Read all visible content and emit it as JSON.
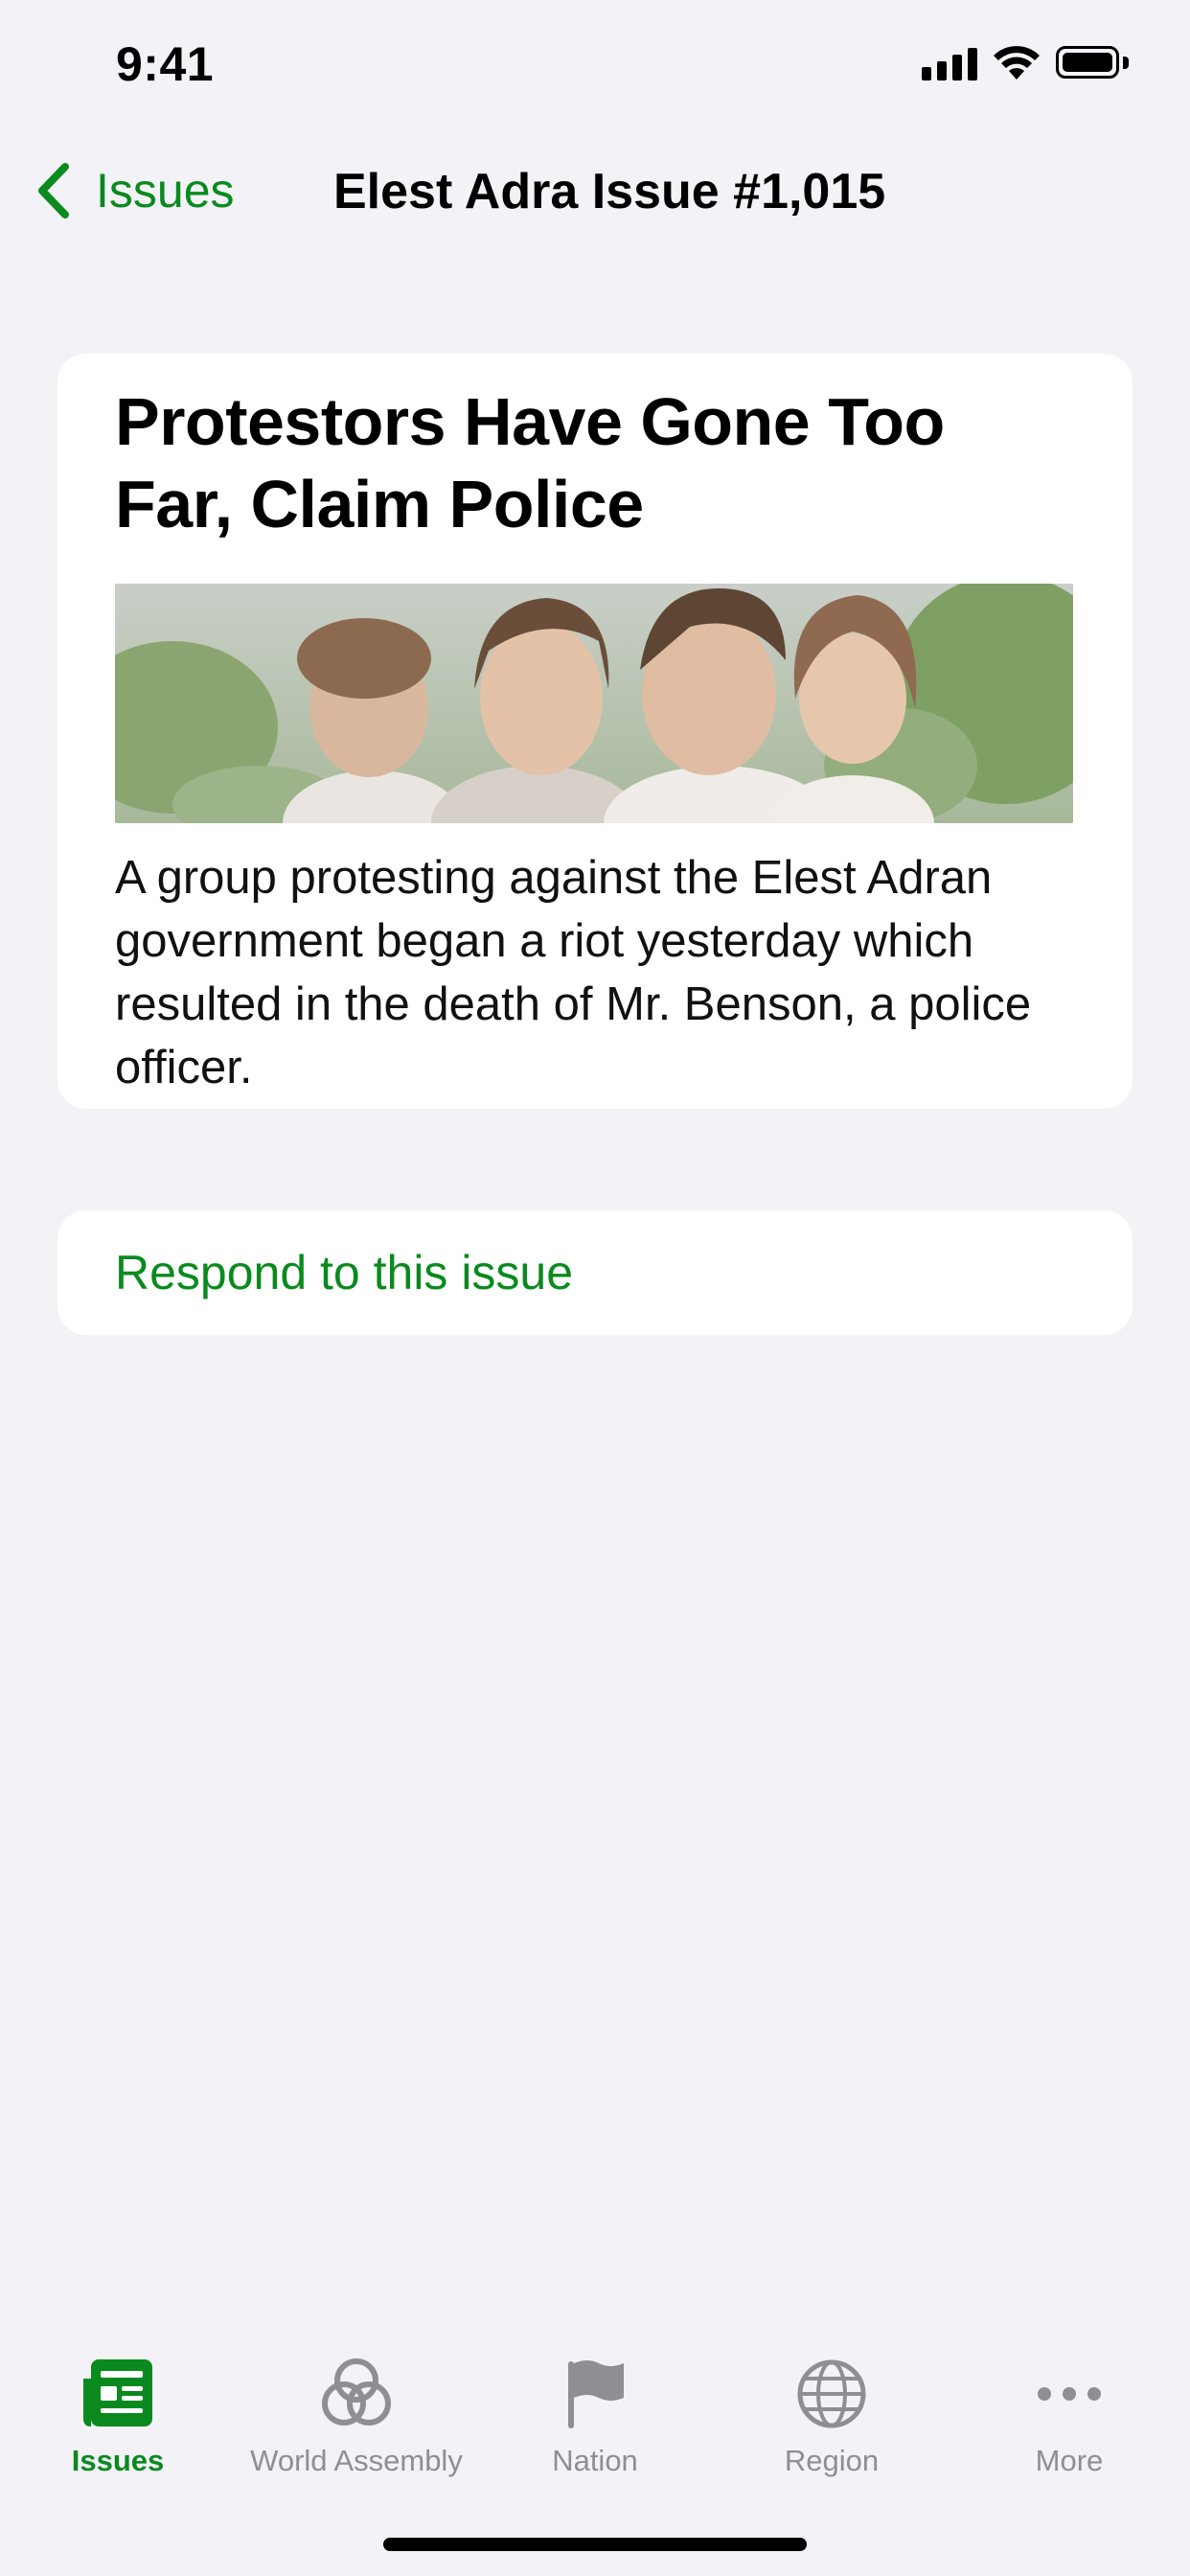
{
  "status": {
    "time": "9:41"
  },
  "nav": {
    "back_label": "Issues",
    "title": "Elest Adra Issue #1,015"
  },
  "issue": {
    "title": "Protestors Have Gone Too Far, Claim Police",
    "description": "A group protesting against the Elest Adran government began a riot yesterday which resulted in the death of Mr. Benson, a police officer."
  },
  "respond": {
    "label": "Respond to this issue"
  },
  "tabs": [
    {
      "label": "Issues",
      "icon": "newspaper-icon",
      "active": true
    },
    {
      "label": "World Assembly",
      "icon": "world-assembly-icon",
      "active": false
    },
    {
      "label": "Nation",
      "icon": "flag-icon",
      "active": false
    },
    {
      "label": "Region",
      "icon": "globe-icon",
      "active": false
    },
    {
      "label": "More",
      "icon": "ellipsis-icon",
      "active": false
    }
  ],
  "colors": {
    "accent": "#0a8a1e",
    "background": "#f2f2f7",
    "inactive": "#8e8e93"
  }
}
